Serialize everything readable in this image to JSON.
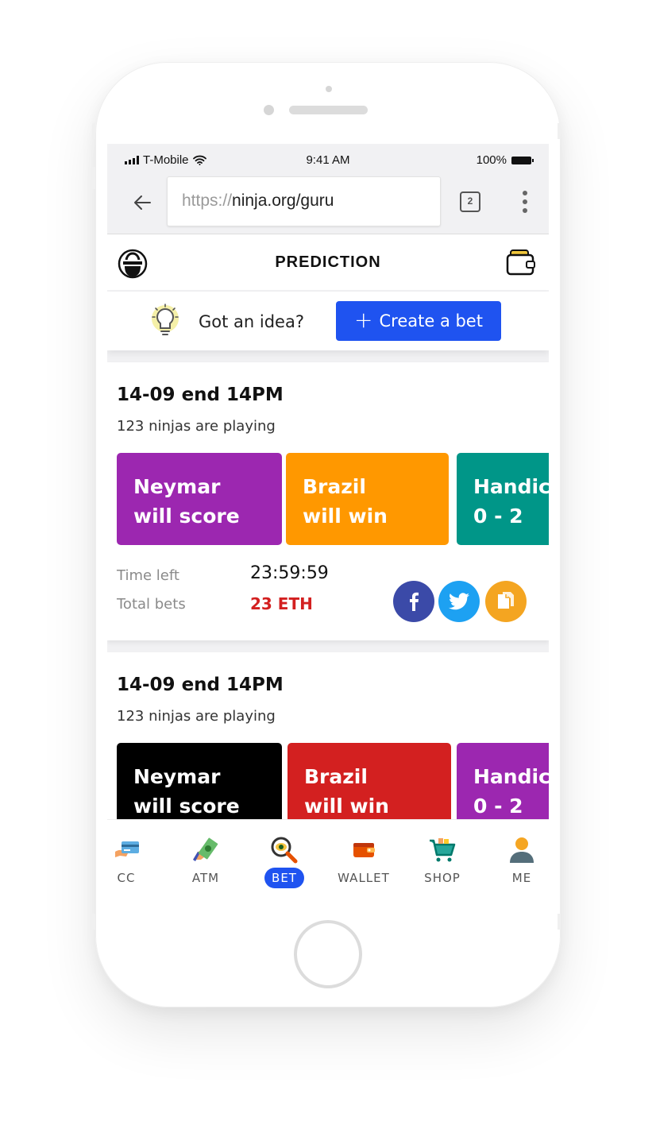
{
  "status": {
    "carrier": "T-Mobile",
    "time": "9:41 AM",
    "battery": "100%"
  },
  "browser": {
    "url_protocol": "https://",
    "url_host": "ninja.org/guru",
    "tab_count": "2"
  },
  "header": {
    "title": "PREDICTION"
  },
  "idea": {
    "text": "Got an idea?",
    "button_label": "Create a bet"
  },
  "cards": [
    {
      "date": "14-09 end 14PM",
      "players": "123 ninjas are playing",
      "options": [
        {
          "line1": "Neymar",
          "line2": "will score",
          "color": "#9c27b0"
        },
        {
          "line1": "Brazil",
          "line2": "will win",
          "color": "#ff9800"
        },
        {
          "line1": "Handicap",
          "line2": "0 - 2",
          "color": "#009688"
        }
      ],
      "time_left_label": "Time left",
      "time_left": "23:59:59",
      "total_bets_label": "Total bets",
      "total_bets": "23 ETH"
    },
    {
      "date": "14-09 end 14PM",
      "players": "123 ninjas are playing",
      "options": [
        {
          "line1": "Neymar",
          "line2": "will score",
          "color": "#000000"
        },
        {
          "line1": "Brazil",
          "line2": "will win",
          "color": "#d32020"
        },
        {
          "line1": "Handicap",
          "line2": "0 - 2",
          "color": "#9c27b0"
        }
      ]
    }
  ],
  "share": [
    {
      "icon": "facebook-icon",
      "color": "#3b4aa8"
    },
    {
      "icon": "twitter-icon",
      "color": "#1da1f2"
    },
    {
      "icon": "copy-icon",
      "color": "#f4a521"
    }
  ],
  "nav": [
    {
      "label": "CC",
      "icon": "credit-card-icon"
    },
    {
      "label": "ATM",
      "icon": "cash-hand-icon"
    },
    {
      "label": "BET",
      "icon": "magnifier-eye-icon",
      "active": true
    },
    {
      "label": "WALLET",
      "icon": "wallet-icon"
    },
    {
      "label": "SHOP",
      "icon": "shopping-cart-icon"
    },
    {
      "label": "ME",
      "icon": "user-icon"
    }
  ],
  "colors": {
    "accent": "#1f53f0",
    "total_bets": "#d32020"
  }
}
